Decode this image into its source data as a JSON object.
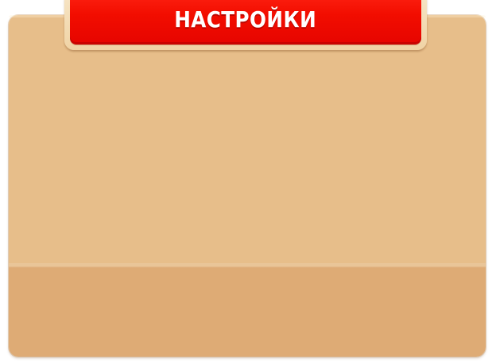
{
  "dialog": {
    "title": "НАСТРОЙКИ"
  },
  "colors": {
    "panel_top": "#e7be8a",
    "panel_bottom": "#deab75",
    "ribbon_red": "#f20d00",
    "title_text": "#ffffff"
  }
}
